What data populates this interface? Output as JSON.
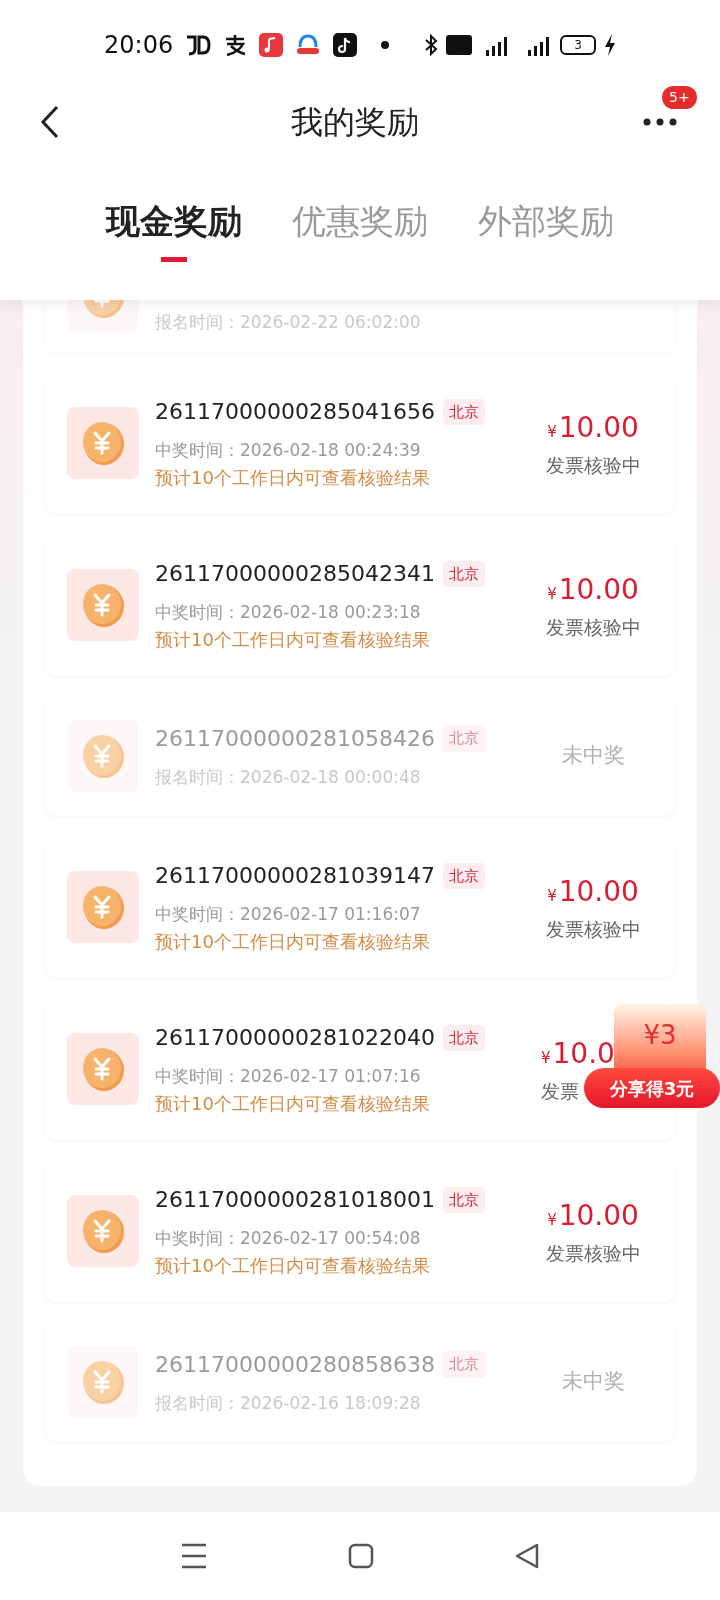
{
  "status_bar": {
    "time": "20:06",
    "battery": "3"
  },
  "header": {
    "title": "我的奖励",
    "menu_badge": "5+"
  },
  "tabs": [
    {
      "label": "现金奖励",
      "selected": true
    },
    {
      "label": "优惠奖励",
      "selected": false
    },
    {
      "label": "外部奖励",
      "selected": false
    }
  ],
  "records": [
    {
      "kind": "partial",
      "time_label": "报名时间：",
      "time": "2026-02-22 06:02:00"
    },
    {
      "kind": "won",
      "id": "26117000000285041656",
      "city": "北京",
      "time_label": "中奖时间：",
      "time": "2026-02-18 00:24:39",
      "note": "预计10个工作日内可查看核验结果",
      "currency": "¥",
      "amount": "10.00",
      "status": "发票核验中"
    },
    {
      "kind": "won",
      "id": "26117000000285042341",
      "city": "北京",
      "time_label": "中奖时间：",
      "time": "2026-02-18 00:23:18",
      "note": "预计10个工作日内可查看核验结果",
      "currency": "¥",
      "amount": "10.00",
      "status": "发票核验中"
    },
    {
      "kind": "lost",
      "id": "26117000000281058426",
      "city": "北京",
      "time_label": "报名时间：",
      "time": "2026-02-18 00:00:48",
      "status": "未中奖"
    },
    {
      "kind": "won",
      "id": "26117000000281039147",
      "city": "北京",
      "time_label": "中奖时间：",
      "time": "2026-02-17 01:16:07",
      "note": "预计10个工作日内可查看核验结果",
      "currency": "¥",
      "amount": "10.00",
      "status": "发票核验中"
    },
    {
      "kind": "won",
      "id": "26117000000281022040",
      "city": "北京",
      "time_label": "中奖时间：",
      "time": "2026-02-17 01:07:16",
      "note": "预计10个工作日内可查看核验结果",
      "currency": "¥",
      "amount": "10.0",
      "status": "发票"
    },
    {
      "kind": "won",
      "id": "26117000000281018001",
      "city": "北京",
      "time_label": "中奖时间：",
      "time": "2026-02-17 00:54:08",
      "note": "预计10个工作日内可查看核验结果",
      "currency": "¥",
      "amount": "10.00",
      "status": "发票核验中"
    },
    {
      "kind": "lost",
      "id": "26117000000280858638",
      "city": "北京",
      "time_label": "报名时间：",
      "time": "2026-02-16 18:09:28",
      "status": "未中奖"
    }
  ],
  "share_float": {
    "envelope_amount": "¥3",
    "button": "分享得3元"
  }
}
